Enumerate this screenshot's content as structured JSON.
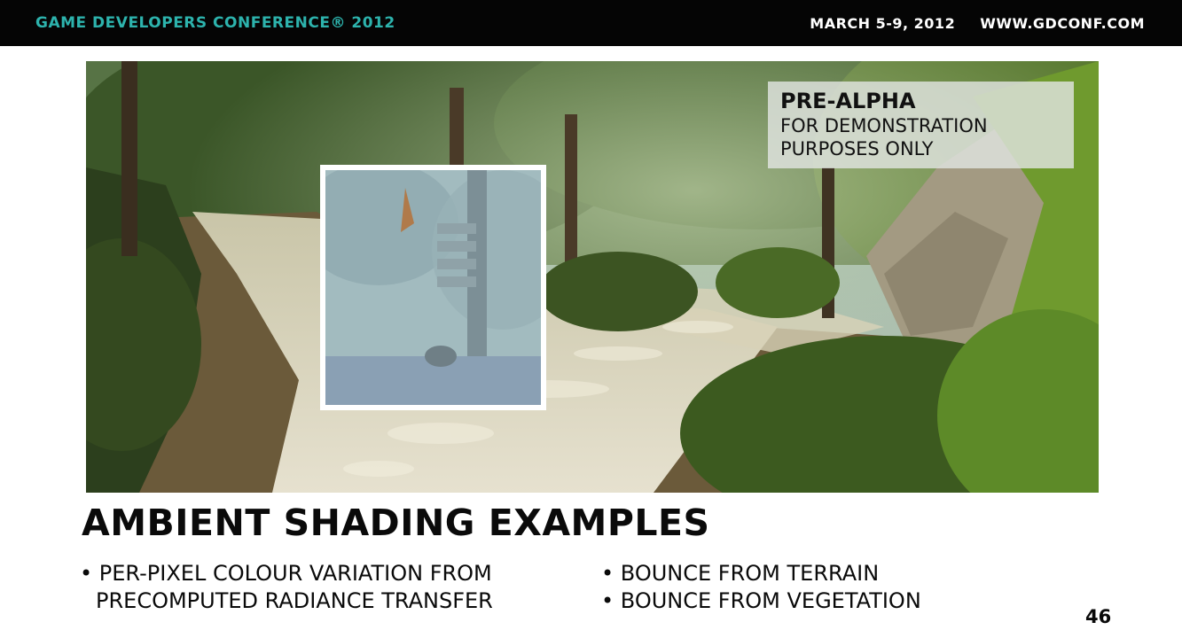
{
  "header": {
    "conference": "GAME DEVELOPERS CONFERENCE® 2012",
    "dates": "MARCH 5-9, 2012",
    "website": "WWW.GDCONF.COM"
  },
  "badge": {
    "line1": "PRE-ALPHA",
    "line2": "FOR DEMONSTRATION",
    "line3": "PURPOSES ONLY"
  },
  "title": "AMBIENT SHADING EXAMPLES",
  "bullets_left": [
    "• PER-PIXEL COLOUR VARIATION FROM",
    "PRECOMPUTED RADIANCE TRANSFER"
  ],
  "bullets_right": [
    "• BOUNCE FROM TERRAIN",
    "• BOUNCE FROM VEGETATION"
  ],
  "page_number": "46",
  "colors": {
    "header_bg": "#050505",
    "header_accent": "#2db3ad",
    "text": "#0a0a0a"
  }
}
